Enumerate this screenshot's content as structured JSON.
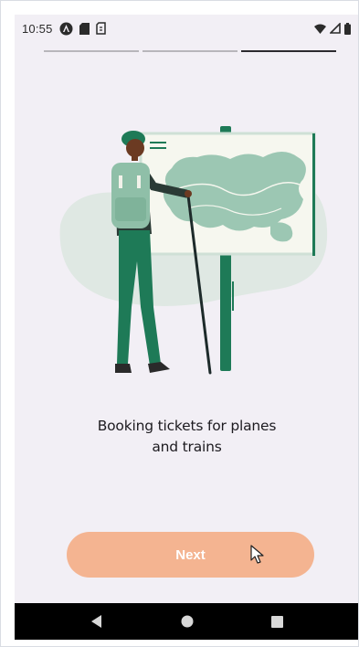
{
  "status_bar": {
    "time": "10:55",
    "left_icons": [
      "android-auto-icon",
      "sd-card-icon",
      "sim-icon"
    ],
    "right_icons": [
      "wifi-icon",
      "signal-icon",
      "battery-icon"
    ]
  },
  "onboarding": {
    "steps_total": 3,
    "active_step": 3,
    "headline_line1": "Booking tickets for planes",
    "headline_line2": "and trains",
    "illustration": "traveler-with-map-illustration"
  },
  "actions": {
    "next_label": "Next"
  },
  "nav_bar": {
    "buttons": [
      "back-icon",
      "home-icon",
      "recents-icon"
    ]
  },
  "colors": {
    "background": "#f2eff5",
    "accent": "#f4b491",
    "illustration_green": "#1e7a57",
    "illustration_light_green": "#9cc7b3",
    "text": "#1d1b20"
  }
}
